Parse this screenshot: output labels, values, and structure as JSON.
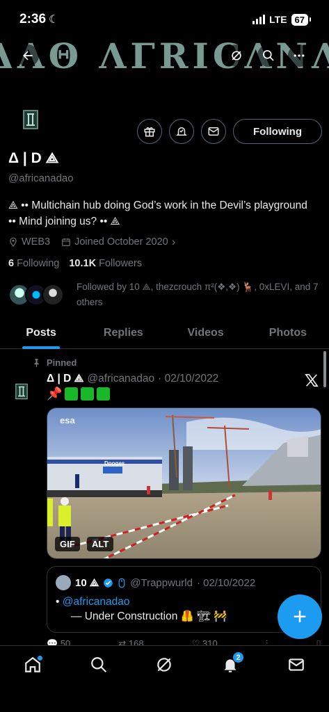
{
  "status_bar": {
    "time": "2:36",
    "network": "LTE",
    "battery": "67"
  },
  "banner": {
    "text": "ΔΛΘ ΛΓRIϹΛNΛ"
  },
  "profile": {
    "name": "Δ | D ⟁",
    "handle": "@africanadao",
    "bio": "⟁ •• Multichain hub doing God’s work in the Devil’s playground •• Mind joining us? •• ⟁",
    "location": "WEB3",
    "joined": "Joined October 2020",
    "following_count": "6",
    "following_label": "Following",
    "followers_count": "10.1K",
    "followers_label": "Followers",
    "followed_by": "Followed by 10 ⟁, thezcrouch π²(❖,❖) 🦌, 0xLEVI, and 7 others",
    "follow_button": "Following"
  },
  "tabs": [
    {
      "label": "Posts"
    },
    {
      "label": "Replies"
    },
    {
      "label": "Videos"
    },
    {
      "label": "Photos"
    }
  ],
  "tweet": {
    "pinned_label": "Pinned",
    "author_name": "Δ | D ⟁",
    "author_handle": "@africanadao",
    "date": "· 02/10/2022",
    "pin_emoji": "📌",
    "media_watermark": "esa",
    "media_sign": "Dooges",
    "gif_badge": "GIF",
    "alt_badge": "ALT",
    "quote": {
      "author_name": "10 ⟁",
      "author_handle": "@Trappwurld",
      "date": "· 02/10/2022",
      "mention": "@africanadao",
      "body_prefix": "•",
      "body": "— Under Construction 🦺 🏗 🚧"
    },
    "actions": {
      "replies": "50",
      "reposts": "168",
      "likes": "310"
    }
  },
  "fab": {
    "label": "+"
  },
  "nav": {
    "notifications_badge": "2"
  },
  "colors": {
    "accent": "#1d9bf0",
    "background": "#000000",
    "muted": "#71767b"
  }
}
